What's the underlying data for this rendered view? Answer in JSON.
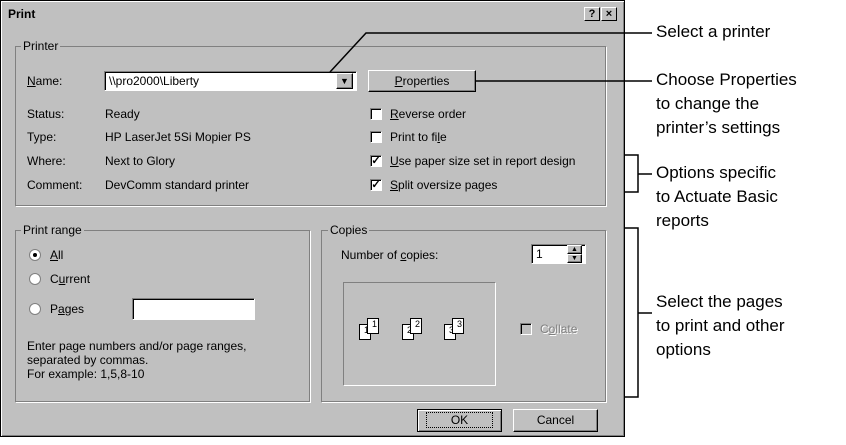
{
  "dialog": {
    "title": "Print",
    "help_btn": "?",
    "close_btn": "×",
    "printer_group": {
      "label": "Printer",
      "name_label": "Name:",
      "name_value": "\\\\pro2000\\Liberty",
      "properties_label": "Properties",
      "status_label": "Status:",
      "status_value": "Ready",
      "type_label": "Type:",
      "type_value": "HP LaserJet 5Si Mopier PS",
      "where_label": "Where:",
      "where_value": "Next to Glory",
      "comment_label": "Comment:",
      "comment_value": "DevComm standard printer",
      "options": [
        {
          "label": "Reverse order",
          "checked": false
        },
        {
          "label": "Print to file",
          "checked": false
        },
        {
          "label": "Use paper size set in report design",
          "checked": true
        },
        {
          "label": "Split oversize pages",
          "checked": true
        }
      ]
    },
    "range_group": {
      "label": "Print range",
      "all": "All",
      "current": "Current",
      "pages": "Pages",
      "pages_value": "",
      "selected": "All",
      "hint_lines": [
        "Enter page numbers and/or page ranges,",
        "separated by commas.",
        "For example: 1,5,8-10"
      ]
    },
    "copies_group": {
      "label": "Copies",
      "num_label": "Number of copies:",
      "num_value": "1",
      "collate_label": "Collate",
      "collate_checked": false,
      "collate_enabled": false
    },
    "ok_label": "OK",
    "cancel_label": "Cancel"
  },
  "annotations": {
    "select_printer": "Select a printer",
    "properties": [
      "Choose Properties",
      "to change the",
      "printer’s settings"
    ],
    "options": [
      "Options specific",
      "to Actuate Basic",
      "reports"
    ],
    "pages": [
      "Select the pages",
      "to print and other",
      "options"
    ]
  }
}
